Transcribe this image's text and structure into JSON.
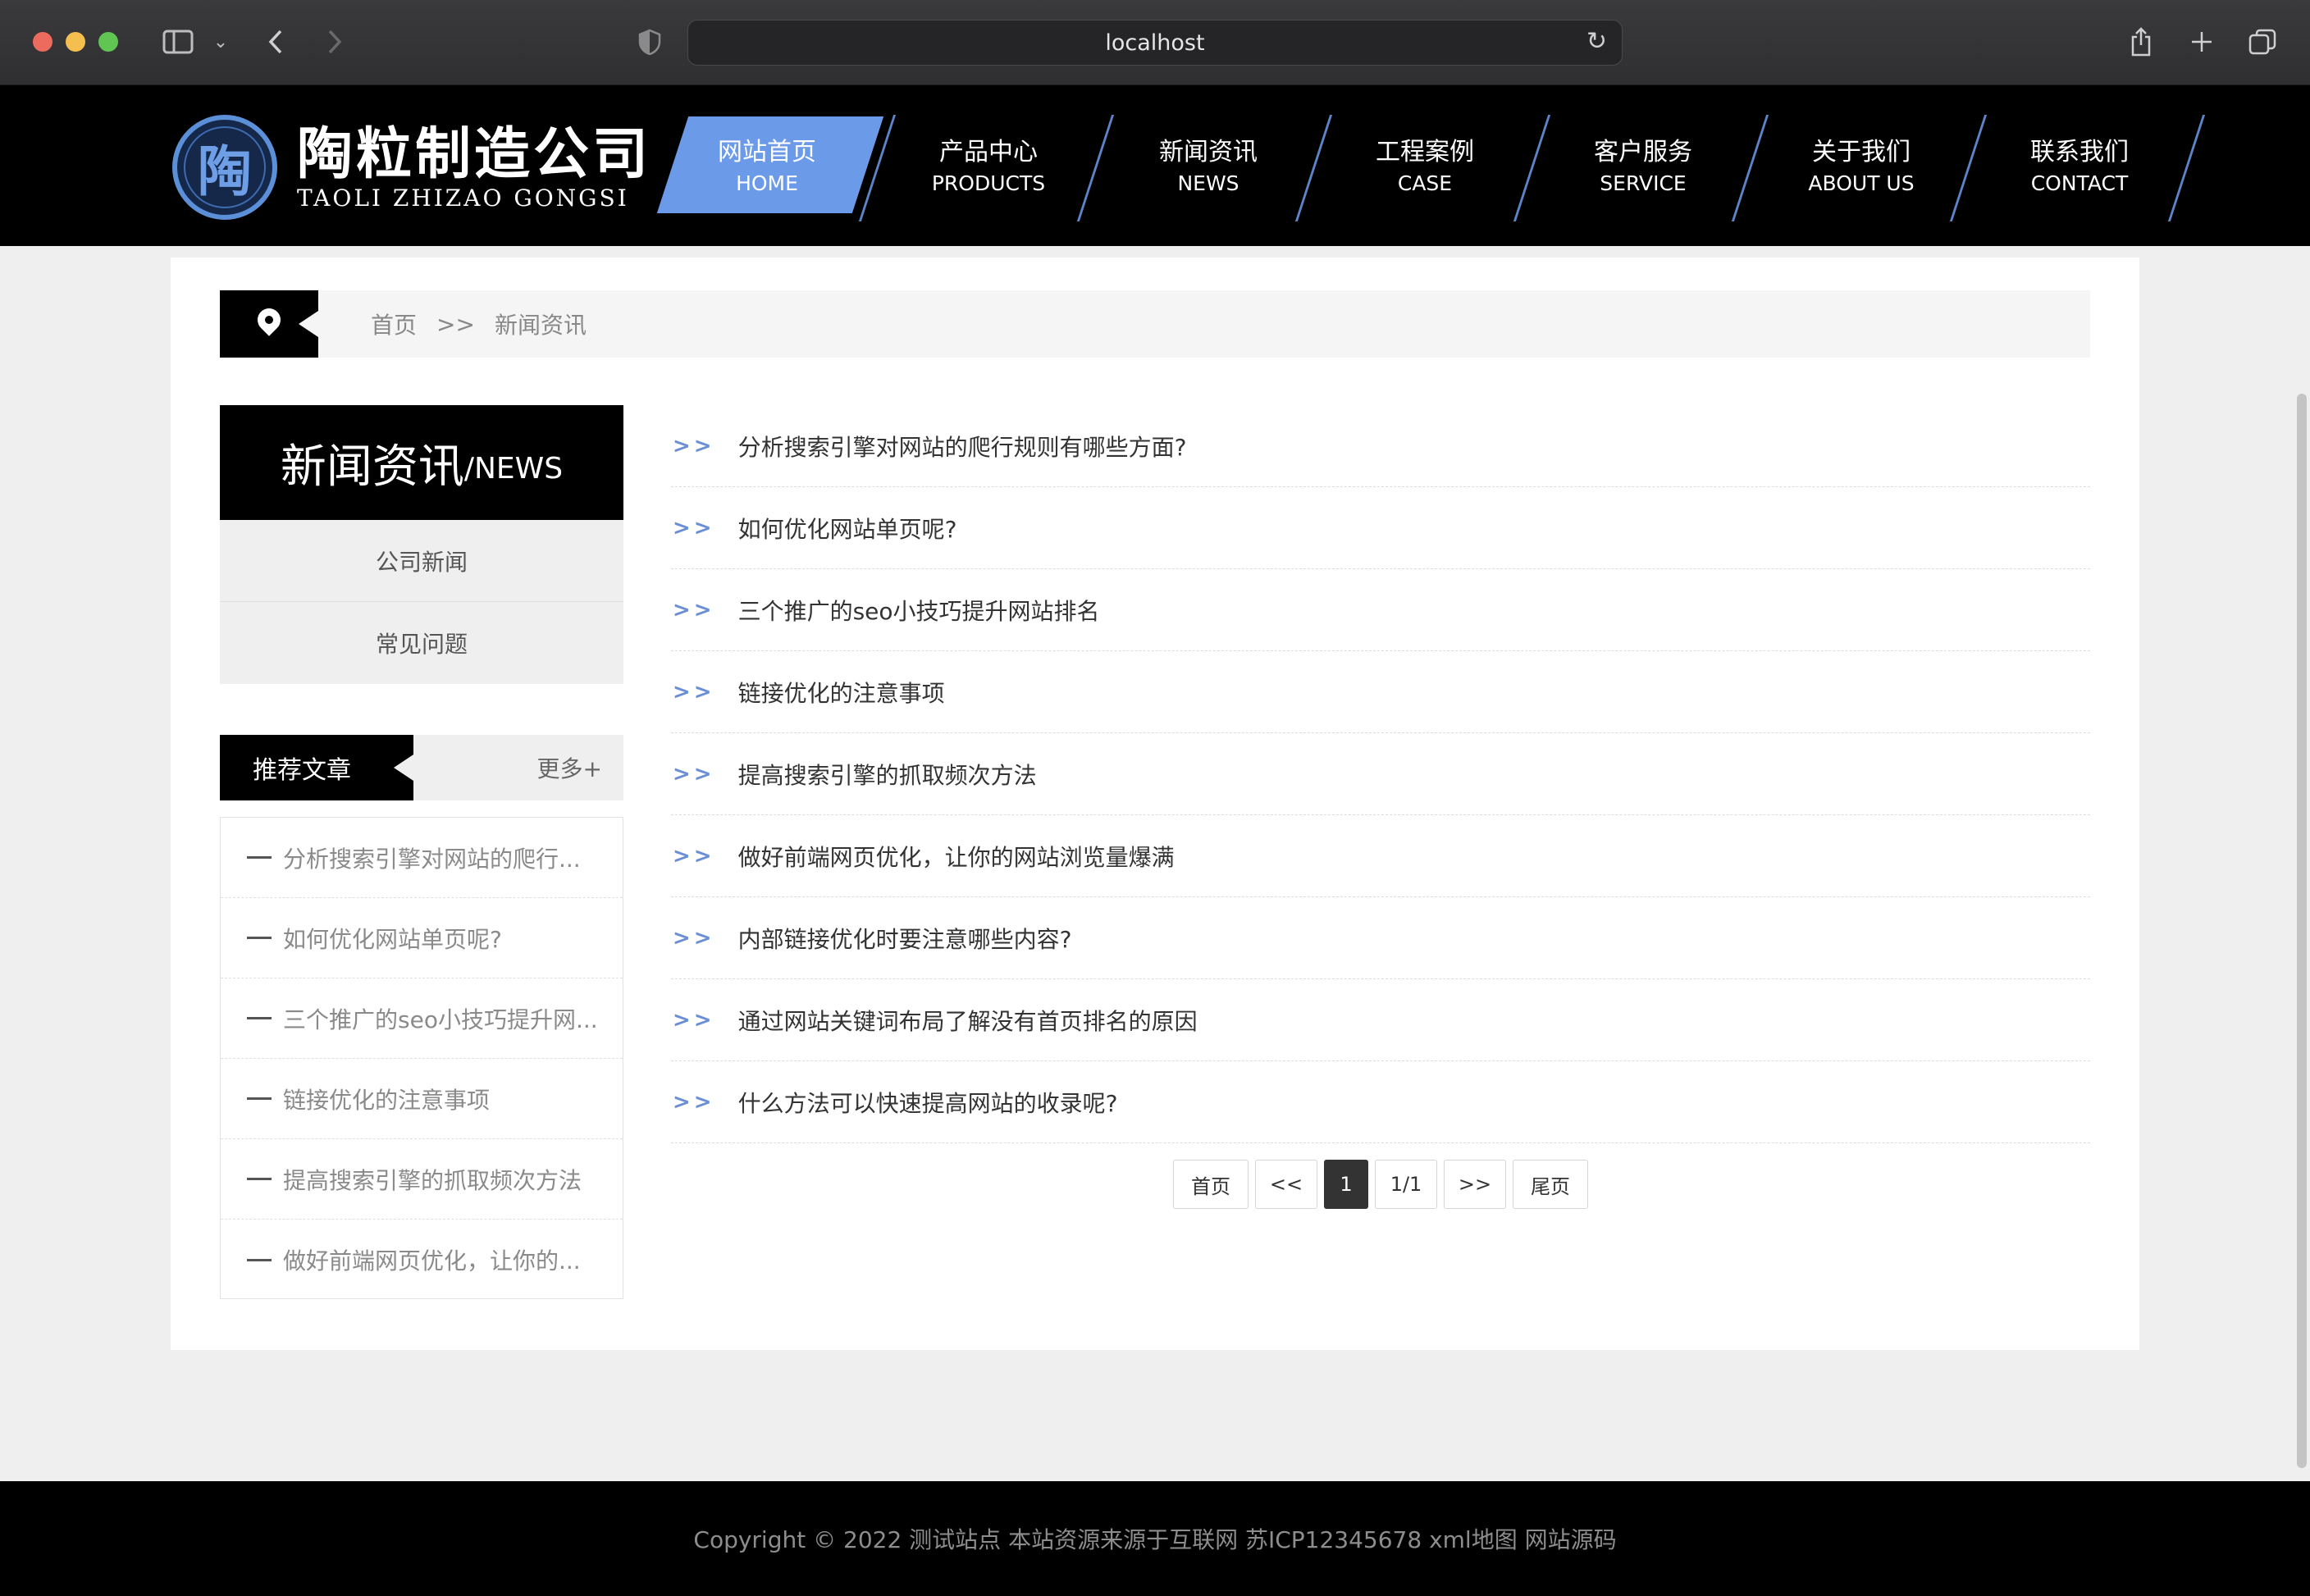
{
  "browser": {
    "url": "localhost"
  },
  "logo": {
    "mark": "陶",
    "name_cn": "陶粒制造公司",
    "name_en": "TAOLI ZHIZAO GONGSI"
  },
  "nav": [
    {
      "cn": "网站首页",
      "en": "HOME",
      "active": true
    },
    {
      "cn": "产品中心",
      "en": "PRODUCTS"
    },
    {
      "cn": "新闻资讯",
      "en": "NEWS"
    },
    {
      "cn": "工程案例",
      "en": "CASE"
    },
    {
      "cn": "客户服务",
      "en": "SERVICE"
    },
    {
      "cn": "关于我们",
      "en": "ABOUT US"
    },
    {
      "cn": "联系我们",
      "en": "CONTACT"
    }
  ],
  "breadcrumb": {
    "home": "首页",
    "sep": ">>",
    "current": "新闻资讯"
  },
  "sidebar": {
    "title_cn": "新闻资讯",
    "title_en": "/NEWS",
    "categories": [
      "公司新闻",
      "常见问题"
    ],
    "recommend_title": "推荐文章",
    "more": "更多+",
    "recommend": [
      "分析搜索引擎对网站的爬行...",
      "如何优化网站单页呢?",
      "三个推广的seo小技巧提升网...",
      "链接优化的注意事项",
      "提高搜索引擎的抓取频次方法",
      "做好前端网页优化，让你的..."
    ]
  },
  "news": {
    "arrow": ">>",
    "items": [
      "分析搜索引擎对网站的爬行规则有哪些方面?",
      "如何优化网站单页呢?",
      "三个推广的seo小技巧提升网站排名",
      "链接优化的注意事项",
      "提高搜索引擎的抓取频次方法",
      "做好前端网页优化，让你的网站浏览量爆满",
      "内部链接优化时要注意哪些内容?",
      "通过网站关键词布局了解没有首页排名的原因",
      "什么方法可以快速提高网站的收录呢?"
    ]
  },
  "pager": {
    "first": "首页",
    "prev": "<<",
    "current": "1",
    "info": "1/1",
    "next": ">>",
    "last": "尾页"
  },
  "footer": {
    "text": "Copyright © 2022 测试站点 本站资源来源于互联网 苏ICP12345678 xml地图 网站源码"
  },
  "colors": {
    "accent": "#6b9be8",
    "header_bg": "#000000",
    "page_bg": "#efefef"
  }
}
